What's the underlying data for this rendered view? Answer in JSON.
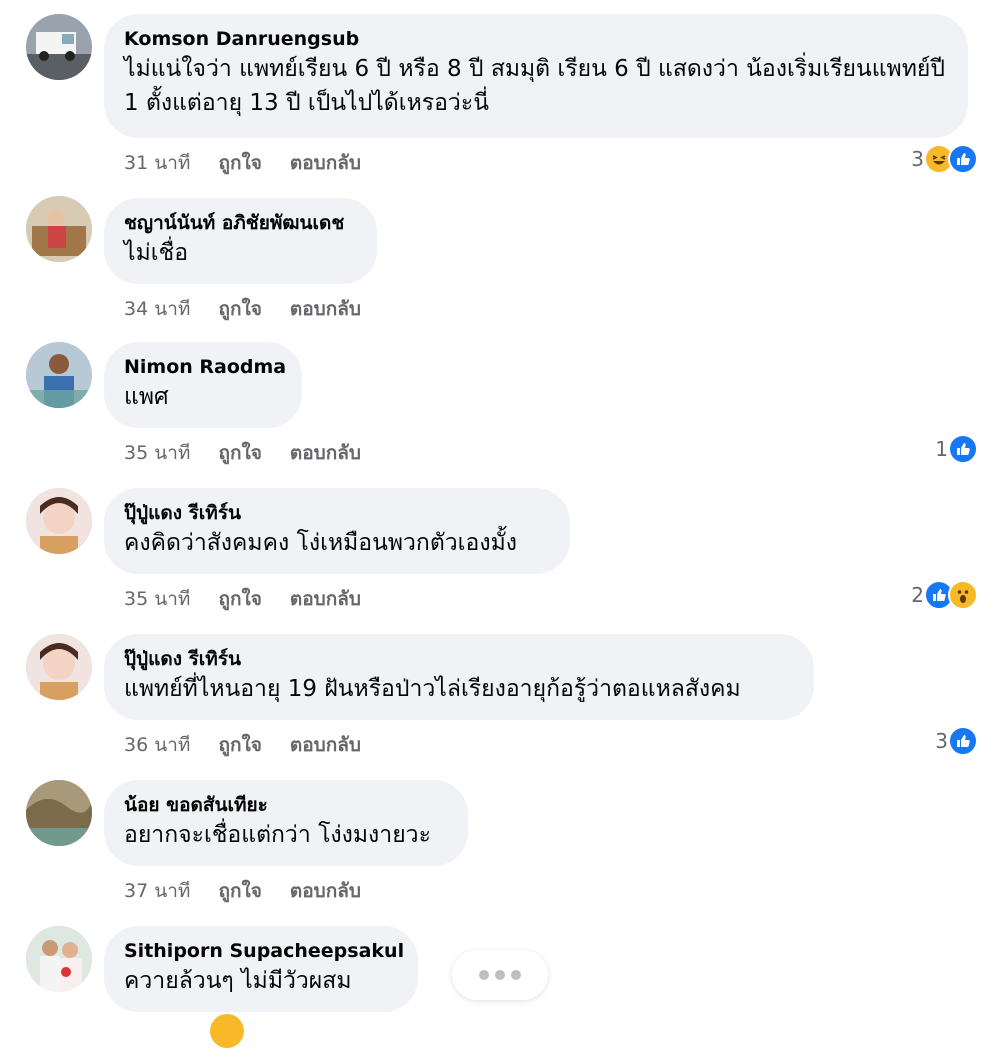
{
  "comments": [
    {
      "author": "Komson Danruengsub",
      "text": "ไม่แน่ใจว่า แพทย์เรียน 6 ปี หรือ 8 ปี สมมุติ เรียน 6 ปี แสดงว่า น้องเริ่มเรียนแพทย์ปี 1 ตั้งแต่อายุ 13 ปี เป็นไปได้เหรอว่ะนี่",
      "time": "31 นาที",
      "like_label": "ถูกใจ",
      "reply_label": "ตอบกลับ",
      "reaction_count": "3",
      "reactions": [
        "haha-icon",
        "like-icon"
      ]
    },
    {
      "author": "ชญาน์นันท์ อภิชัยพัฒนเดช",
      "text": "ไม่เชื่อ",
      "time": "34 นาที",
      "like_label": "ถูกใจ",
      "reply_label": "ตอบกลับ",
      "reaction_count": "",
      "reactions": []
    },
    {
      "author": "Nimon Raodma",
      "text": "แพศ",
      "time": "35 นาที",
      "like_label": "ถูกใจ",
      "reply_label": "ตอบกลับ",
      "reaction_count": "1",
      "reactions": [
        "like-icon"
      ]
    },
    {
      "author": "ปุ๊ปู่แดง รีเทิร์น",
      "text": "คงคิดว่าสังคมคง โง่เหมือนพวกตัวเองมั้ง",
      "time": "35 นาที",
      "like_label": "ถูกใจ",
      "reply_label": "ตอบกลับ",
      "reaction_count": "2",
      "reactions": [
        "like-icon",
        "wow-icon"
      ]
    },
    {
      "author": "ปุ๊ปู่แดง รีเทิร์น",
      "text": "แพทย์ที่ไหนอายุ 19 ฝันหรือป่าวไล่เรียงอายุก้อรู้ว่าตอแหลสังคม",
      "time": "36 นาที",
      "like_label": "ถูกใจ",
      "reply_label": "ตอบกลับ",
      "reaction_count": "3",
      "reactions": [
        "like-icon"
      ]
    },
    {
      "author": "น้อย ขอดสันเทียะ",
      "text": "อยากจะเชื่อแต่กว่า โง่งมงายวะ",
      "time": "37 นาที",
      "like_label": "ถูกใจ",
      "reply_label": "ตอบกลับ",
      "reaction_count": "",
      "reactions": []
    },
    {
      "author": "Sithiporn Supacheepsakul",
      "text": "ควายล้วนๆ   ไม่มีวัวผสม",
      "time": "",
      "like_label": "",
      "reply_label": "",
      "reaction_count": "",
      "reactions": []
    }
  ],
  "colors": {
    "bubble": "#f0f2f5",
    "meta_text": "#65676b",
    "like_blue": "#1877f2",
    "emoji_yellow": "#f7b928"
  }
}
